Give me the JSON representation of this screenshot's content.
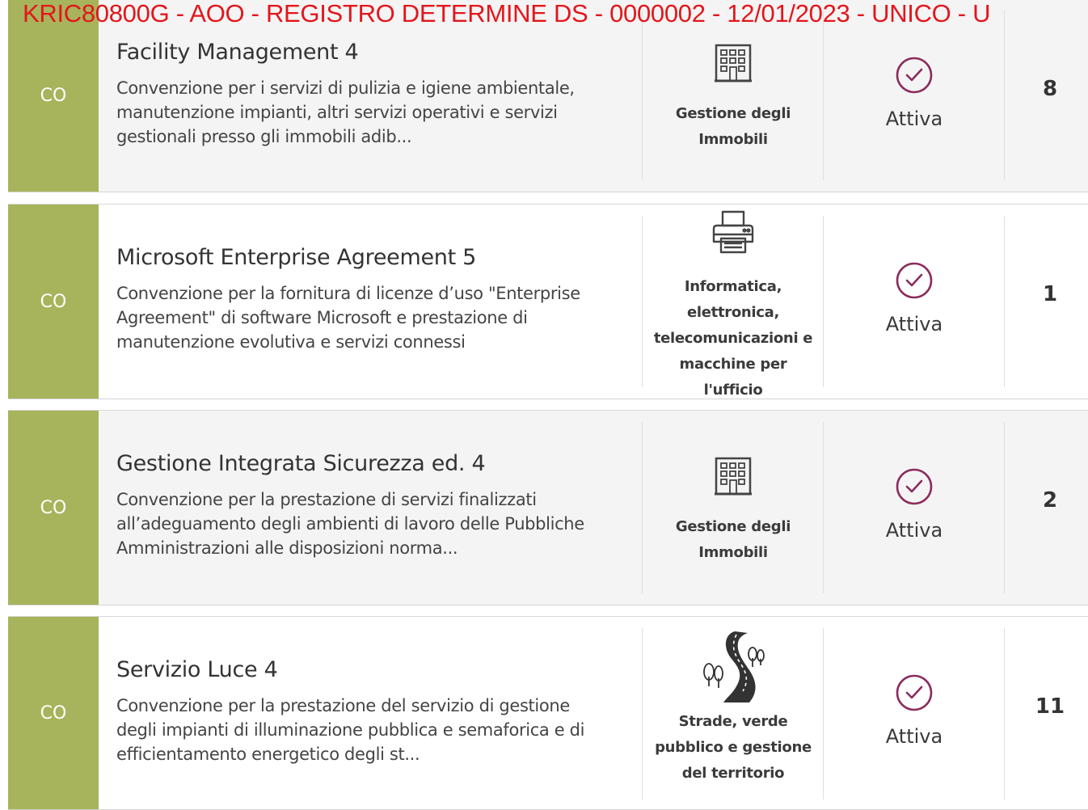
{
  "header_stamp": "KRIC80800G - AOO - REGISTRO DETERMINE DS - 0000002 - 12/01/2023 - UNICO - U",
  "rows": [
    {
      "tag": "CO",
      "title": "Facility Management 4",
      "description": "Convenzione per i servizi di pulizia e igiene ambientale, manutenzione impianti, altri servizi operativi e servizi gestionali presso gli immobili adib...",
      "category_icon": "building-icon",
      "category": "Gestione degli Immobili",
      "status": "Attiva",
      "count": "8"
    },
    {
      "tag": "CO",
      "title": "Microsoft Enterprise Agreement 5",
      "description": "Convenzione per la fornitura di licenze d’uso \"Enterprise Agreement\" di software Microsoft e prestazione di manutenzione evolutiva e servizi connessi",
      "category_icon": "printer-icon",
      "category": "Informatica, elettronica, telecomunicazioni e macchine per l'ufficio",
      "status": "Attiva",
      "count": "1"
    },
    {
      "tag": "CO",
      "title": "Gestione Integrata Sicurezza ed. 4",
      "description": "Convenzione per la prestazione di servizi finalizzati all’adeguamento degli ambienti di lavoro delle Pubbliche Amministrazioni alle disposizioni norma...",
      "category_icon": "building-icon",
      "category": "Gestione degli Immobili",
      "status": "Attiva",
      "count": "2"
    },
    {
      "tag": "CO",
      "title": "Servizio Luce 4",
      "description": "Convenzione per la prestazione del servizio di gestione degli impianti di illuminazione pubblica e semaforica e di efficientamento energetico degli st...",
      "category_icon": "road-trees-icon",
      "category": "Strade, verde pubblico e gestione del territorio",
      "status": "Attiva",
      "count": "11"
    }
  ],
  "colors": {
    "tag_bg": "#a7b45b",
    "status_icon": "#8b2c5e",
    "stamp": "#e3161b"
  }
}
